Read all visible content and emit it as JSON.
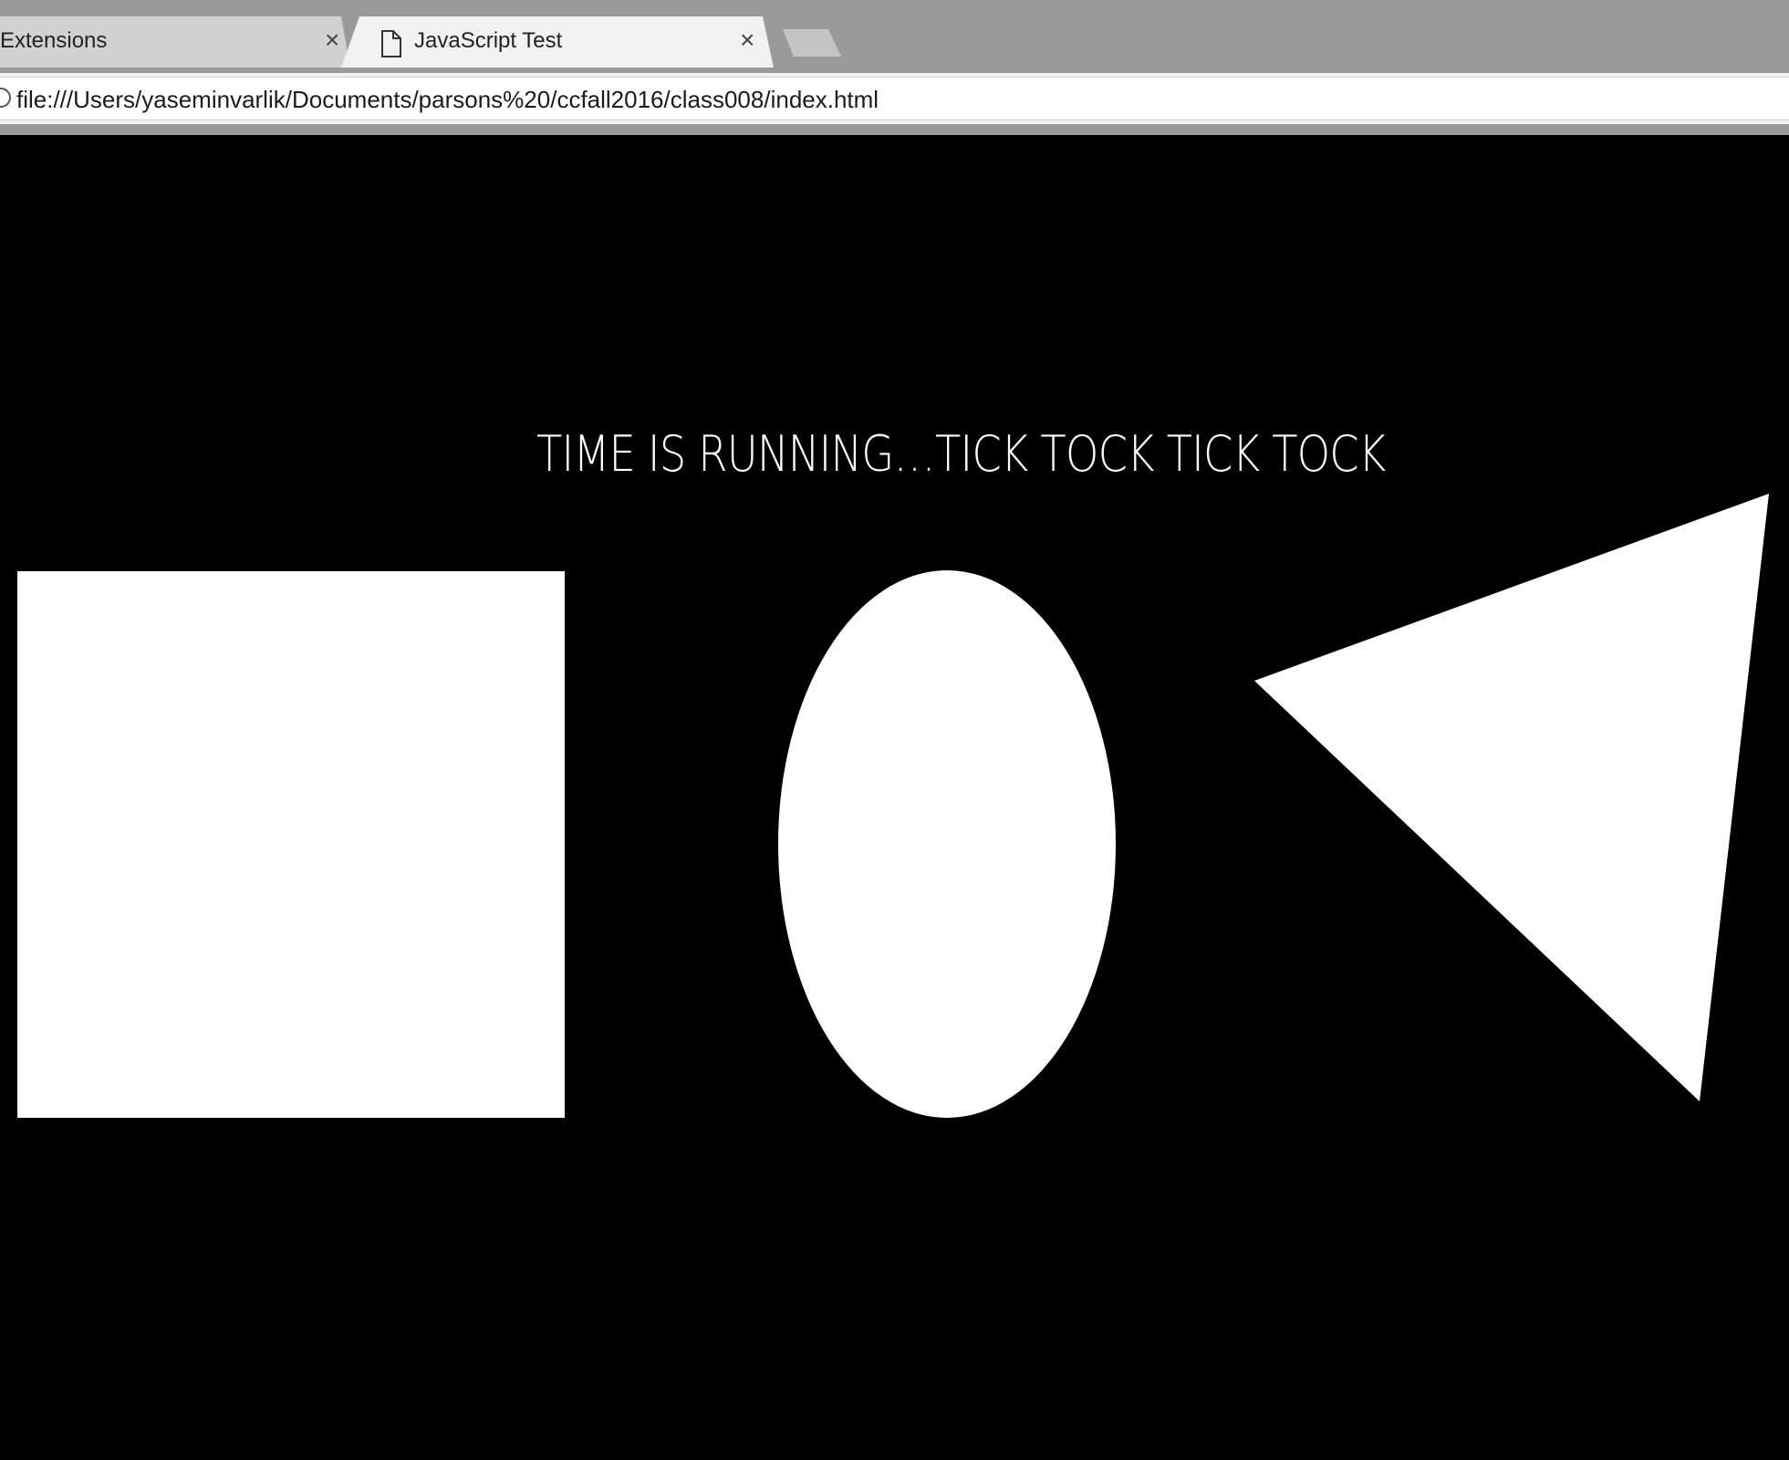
{
  "browser": {
    "tabs": [
      {
        "title": "Extensions",
        "active": false
      },
      {
        "title": "JavaScript Test",
        "active": true
      }
    ],
    "close_glyph": "×",
    "url": "file:///Users/yaseminvarlik/Documents/parsons%20/ccfall2016/class008/index.html"
  },
  "page": {
    "heading": "TIME IS RUNNING…TICK TOCK TICK TOCK",
    "background_color": "#000000",
    "shape_color": "#ffffff"
  }
}
